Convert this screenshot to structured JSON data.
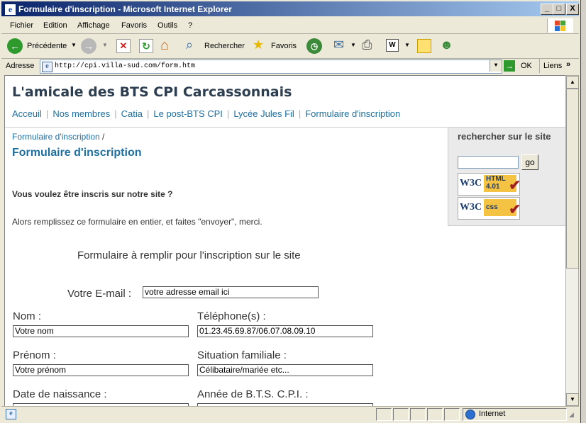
{
  "window": {
    "title": "Formulaire d'inscription - Microsoft Internet Explorer",
    "controls": [
      "_",
      "□",
      "X"
    ]
  },
  "menu": [
    "Fichier",
    "Edition",
    "Affichage",
    "Favoris",
    "Outils",
    "?"
  ],
  "toolbar": {
    "back_label": "Précédente",
    "search_label": "Rechercher",
    "favorites_label": "Favoris"
  },
  "address": {
    "label": "Adresse",
    "url": "http://cpi.villa-sud.com/form.htm",
    "go_label": "OK",
    "links_label": "Liens"
  },
  "status": {
    "zone": "Internet"
  },
  "page": {
    "site_title": "L'amicale des BTS CPI Carcassonnais",
    "nav": [
      "Acceuil",
      "Nos membres",
      "Catia",
      "Le post-BTS CPI",
      "Lycée Jules Fil",
      "Formulaire d'inscription"
    ],
    "breadcrumb": "Formulaire d'inscription",
    "breadcrumb_sep": "/",
    "heading": "Formulaire d'inscription",
    "intro_question": "Vous voulez être inscris sur notre site ?",
    "intro_text": "Alors remplissez ce formulaire en entier, et faites \"envoyer\", merci.",
    "search": {
      "label": "rechercher sur le site",
      "go": "go",
      "badge_html": "HTML 4.01",
      "badge_css": "css",
      "w3c": "W3C"
    },
    "form": {
      "caption": "Formulaire à remplir pour l'inscription sur le site",
      "email_label": "Votre E-mail :",
      "email_value": "votre adresse email ici",
      "nom_label": "Nom :",
      "nom_value": "Votre nom",
      "tel_label": "Téléphone(s) :",
      "tel_value": "01.23.45.69.87/06.07.08.09.10",
      "prenom_label": "Prénom :",
      "prenom_value": "Votre prénom",
      "situation_label": "Situation familiale :",
      "situation_value": "Célibataire/mariée etc...",
      "naissance_label": "Date de naissance :",
      "annee_label": "Année de B.T.S. C.P.I. :"
    }
  }
}
